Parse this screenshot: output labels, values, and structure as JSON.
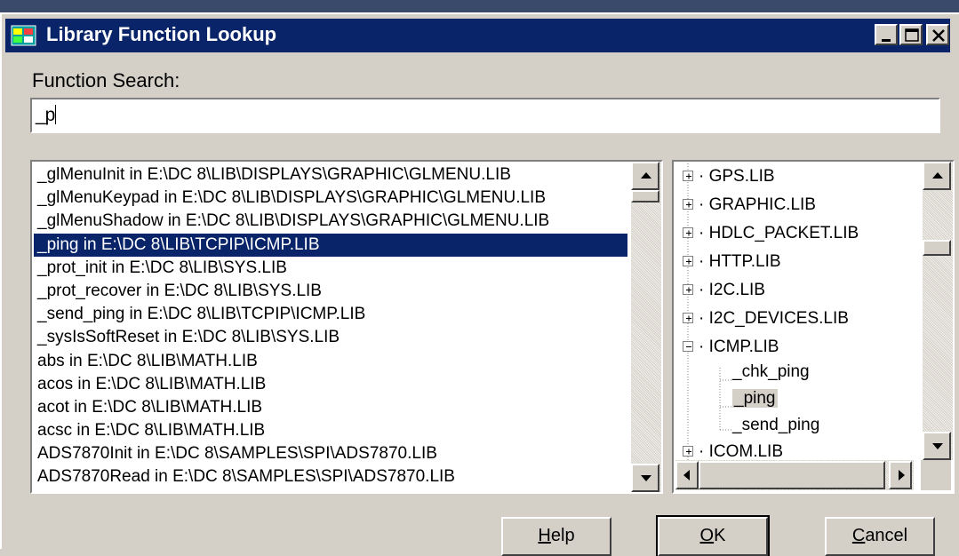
{
  "window": {
    "title": "Library Function Lookup"
  },
  "search": {
    "label": "Function Search:",
    "value": "_p"
  },
  "results": [
    "_glMenuInit in E:\\DC 8\\LIB\\DISPLAYS\\GRAPHIC\\GLMENU.LIB",
    "_glMenuKeypad in E:\\DC 8\\LIB\\DISPLAYS\\GRAPHIC\\GLMENU.LIB",
    "_glMenuShadow in E:\\DC 8\\LIB\\DISPLAYS\\GRAPHIC\\GLMENU.LIB",
    "_ping in E:\\DC 8\\LIB\\TCPIP\\ICMP.LIB",
    "_prot_init in E:\\DC 8\\LIB\\SYS.LIB",
    "_prot_recover in E:\\DC 8\\LIB\\SYS.LIB",
    "_send_ping in E:\\DC 8\\LIB\\TCPIP\\ICMP.LIB",
    "_sysIsSoftReset in E:\\DC 8\\LIB\\SYS.LIB",
    "abs in E:\\DC 8\\LIB\\MATH.LIB",
    "acos in E:\\DC 8\\LIB\\MATH.LIB",
    "acot in E:\\DC 8\\LIB\\MATH.LIB",
    "acsc in E:\\DC 8\\LIB\\MATH.LIB",
    "ADS7870Init in E:\\DC 8\\SAMPLES\\SPI\\ADS7870.LIB",
    "ADS7870Read in E:\\DC 8\\SAMPLES\\SPI\\ADS7870.LIB"
  ],
  "selected_result": "_ping in E:\\DC 8\\LIB\\TCPIP\\ICMP.LIB",
  "tree": {
    "nodes": [
      {
        "label": "GPS.LIB",
        "expanded": false
      },
      {
        "label": "GRAPHIC.LIB",
        "expanded": false
      },
      {
        "label": "HDLC_PACKET.LIB",
        "expanded": false
      },
      {
        "label": "HTTP.LIB",
        "expanded": false
      },
      {
        "label": "I2C.LIB",
        "expanded": false
      },
      {
        "label": "I2C_DEVICES.LIB",
        "expanded": false
      },
      {
        "label": "ICMP.LIB",
        "expanded": true
      }
    ],
    "children": [
      "_chk_ping",
      "_ping",
      "_send_ping"
    ],
    "partial_node": "ICOM.LIB",
    "selected_child": "_ping"
  },
  "buttons": {
    "help": "Help",
    "ok": "OK",
    "cancel": "Cancel"
  },
  "colors": {
    "titlebar": "#0a246a",
    "selection": "#0a246a",
    "face": "#d4d0c8"
  }
}
